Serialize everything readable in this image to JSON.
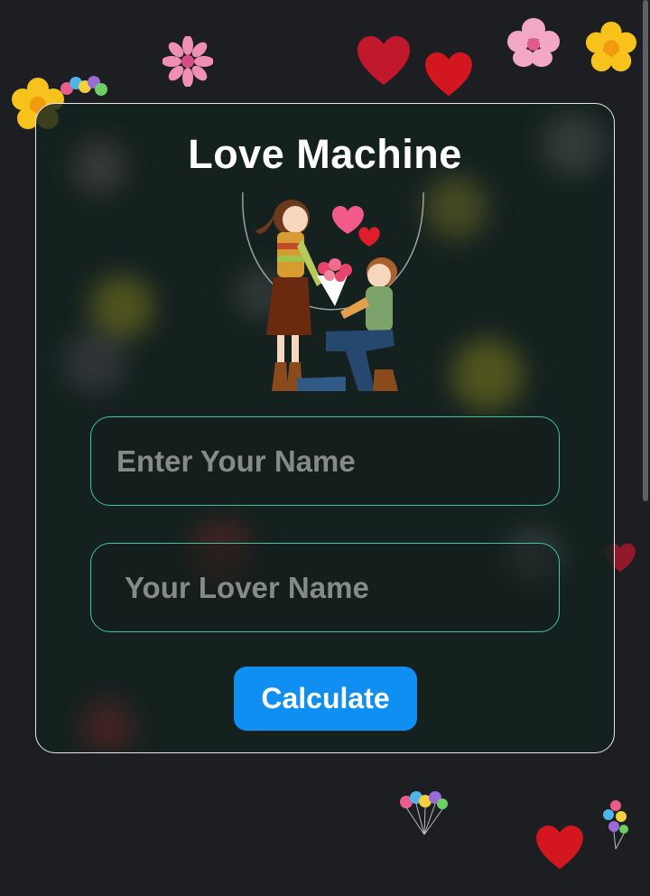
{
  "app": {
    "title": "Love Machine"
  },
  "form": {
    "name_placeholder": "Enter Your Name",
    "lover_placeholder": "Your Lover Name",
    "calculate_label": "Calculate"
  },
  "colors": {
    "background": "#1c1e22",
    "card_border": "#e8e8e8",
    "field_border": "#35c7a5",
    "button": "#0f8ff2",
    "button_text": "#ffffff"
  },
  "icons": [
    "flower-icon",
    "heart-icon",
    "balloons-icon",
    "couple-illustration"
  ]
}
